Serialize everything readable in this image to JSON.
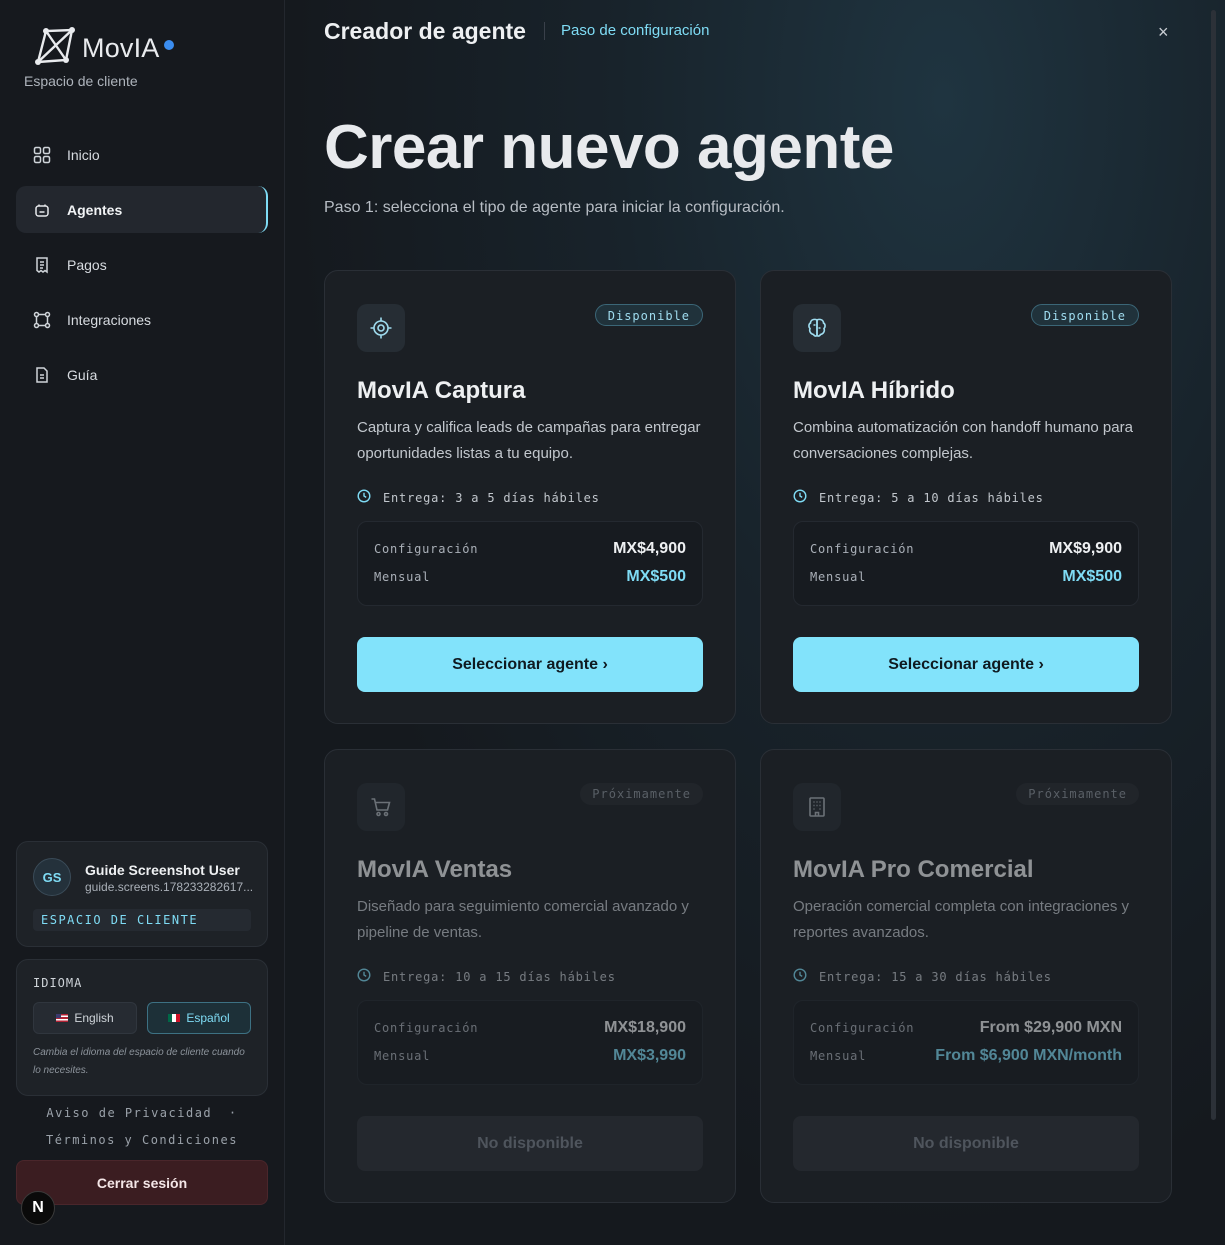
{
  "brand": {
    "name": "MovIA",
    "subtitle": "Espacio de cliente"
  },
  "nav": [
    {
      "label": "Inicio",
      "icon": "grid-icon",
      "active": false
    },
    {
      "label": "Agentes",
      "icon": "bot-icon",
      "active": true
    },
    {
      "label": "Pagos",
      "icon": "receipt-icon",
      "active": false
    },
    {
      "label": "Integraciones",
      "icon": "nodes-icon",
      "active": false
    },
    {
      "label": "Guía",
      "icon": "document-icon",
      "active": false
    }
  ],
  "user": {
    "initials": "GS",
    "name": "Guide Screenshot User",
    "email": "guide.screens.178233282617...",
    "role_badge": "ESPACIO DE CLIENTE"
  },
  "language": {
    "title": "IDIOMA",
    "options": [
      {
        "label": "English",
        "selected": false
      },
      {
        "label": "Español",
        "selected": true
      }
    ],
    "note": "Cambia el idioma del espacio de cliente cuando lo necesites."
  },
  "legal": {
    "privacy": "Aviso de Privacidad",
    "separator": "·",
    "terms": "Términos y Condiciones"
  },
  "logout_label": "Cerrar sesión",
  "dev_badge": "N",
  "header": {
    "title": "Creador de agente",
    "step": "Paso de configuración",
    "close": "×"
  },
  "hero": {
    "title": "Crear nuevo agente",
    "subtitle": "Paso 1: selecciona el tipo de agente para iniciar la configuración."
  },
  "labels": {
    "config": "Configuración",
    "monthly": "Mensual"
  },
  "agents": [
    {
      "name": "MovIA Captura",
      "status": "Disponible",
      "icon": "target-icon",
      "description": "Captura y califica leads de campañas para entregar oportunidades listas a tu equipo.",
      "delivery": "Entrega: 3 a 5 días hábiles",
      "setup_price": "MX$4,900",
      "monthly_price": "MX$500",
      "button": "Seleccionar agente ›"
    },
    {
      "name": "MovIA Híbrido",
      "status": "Disponible",
      "icon": "brain-icon",
      "description": "Combina automatización con handoff humano para conversaciones complejas.",
      "delivery": "Entrega: 5 a 10 días hábiles",
      "setup_price": "MX$9,900",
      "monthly_price": "MX$500",
      "button": "Seleccionar agente ›"
    },
    {
      "name": "MovIA Ventas",
      "status": "Próximamente",
      "icon": "cart-icon",
      "description": "Diseñado para seguimiento comercial avanzado y pipeline de ventas.",
      "delivery": "Entrega: 10 a 15 días hábiles",
      "setup_price": "MX$18,900",
      "monthly_price": "MX$3,990",
      "button": "No disponible"
    },
    {
      "name": "MovIA Pro Comercial",
      "status": "Próximamente",
      "icon": "building-icon",
      "description": "Operación comercial completa con integraciones y reportes avanzados.",
      "delivery": "Entrega: 15 a 30 días hábiles",
      "setup_price": "From $29,900 MXN",
      "monthly_price": "From $6,900 MXN/month",
      "button": "No disponible"
    }
  ],
  "colors": {
    "accent": "#7fdcf5",
    "button": "#82e3fb",
    "logout_bg": "#3b1d21"
  }
}
